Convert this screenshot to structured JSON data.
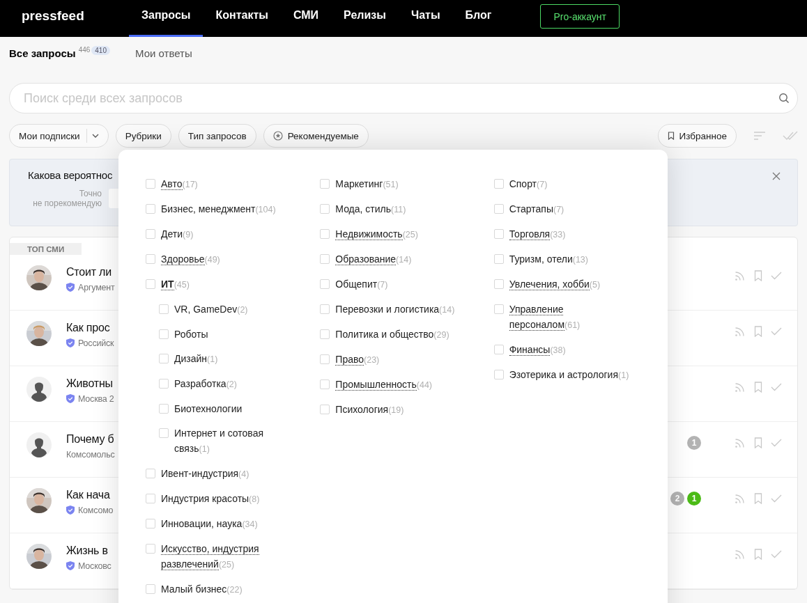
{
  "header": {
    "logo": "pressfeed",
    "nav": [
      {
        "label": "Запросы",
        "selected": true
      },
      {
        "label": "Контакты",
        "selected": false
      },
      {
        "label": "СМИ",
        "selected": false
      },
      {
        "label": "Релизы",
        "selected": false
      },
      {
        "label": "Чаты",
        "selected": false
      },
      {
        "label": "Блог",
        "selected": false
      }
    ],
    "pro_button": "Pro-аккаунт"
  },
  "subtabs": [
    {
      "label": "Все запросы",
      "count": "446",
      "badge": "410",
      "selected": true
    },
    {
      "label": "Мои ответы",
      "selected": false
    }
  ],
  "search": {
    "placeholder": "Поиск среди всех запросов"
  },
  "filters": [
    {
      "label": "Мои подписки",
      "kind": "dropdown"
    },
    {
      "label": "Рубрики",
      "kind": "plain"
    },
    {
      "label": "Тип запросов",
      "kind": "plain"
    },
    {
      "label": "Рекомендуемые",
      "kind": "star"
    }
  ],
  "favorites": "Избранное",
  "banner": {
    "question": "Какова вероятнос",
    "scale_low": [
      "Точно",
      "не порекомендую"
    ]
  },
  "list": {
    "tag": "ТОП СМИ",
    "rows": [
      {
        "title": "Стоит ли",
        "source": "Аргумент",
        "verified": true,
        "avatar": {
          "kind": "picture"
        },
        "badges": []
      },
      {
        "title": "Как прос",
        "source": "Российск",
        "verified": true,
        "avatar": {
          "kind": "picture"
        },
        "badges": []
      },
      {
        "title": "Животны",
        "source": "Москва 2",
        "verified": true,
        "avatar": {
          "kind": "silhouette"
        },
        "badges": []
      },
      {
        "title": "Почему б",
        "source": "Комсомольс",
        "verified": false,
        "avatar": {
          "kind": "silhouette"
        },
        "badges": [
          {
            "text": "1",
            "color": "#b3b3b3"
          }
        ]
      },
      {
        "title": "Как нача",
        "source": "Комсомо",
        "verified": true,
        "avatar": {
          "kind": "picture"
        },
        "badges": [
          {
            "text": "2",
            "color": "#b3b3b3"
          },
          {
            "text": "1",
            "color": "#4cbb17"
          }
        ]
      },
      {
        "title": "Жизнь в",
        "source": "Московс",
        "verified": true,
        "avatar": {
          "kind": "picture"
        },
        "badges": []
      }
    ]
  },
  "rubrics": {
    "columns": [
      [
        {
          "label": "Авто",
          "count": "(17)",
          "dotted": true,
          "checked": false
        },
        {
          "label": "Бизнес, менеджмент",
          "count": "(104)",
          "dotted": false,
          "checked": false
        },
        {
          "label": "Дети",
          "count": "(9)",
          "dotted": false,
          "checked": false
        },
        {
          "label": "Здоровье",
          "count": "(49)",
          "dotted": true,
          "checked": false
        },
        {
          "label": "ИТ",
          "count": "(45)",
          "dotted": true,
          "checked": false,
          "expanded": true,
          "children": [
            {
              "label": "VR, GameDev",
              "count": "(2)",
              "dotted": false,
              "checked": false
            },
            {
              "label": "Роботы",
              "dotted": false,
              "checked": false
            },
            {
              "label": "Дизайн",
              "count": "(1)",
              "dotted": false,
              "checked": false
            },
            {
              "label": "Разработка",
              "count": "(2)",
              "dotted": false,
              "checked": false
            },
            {
              "label": "Биотехнологии",
              "dotted": false,
              "checked": false
            },
            {
              "label": "Интернет и сотовая связь",
              "count": "(1)",
              "dotted": false,
              "checked": false
            }
          ]
        },
        {
          "label": "Ивент-индустрия",
          "count": "(4)",
          "dotted": false,
          "checked": false
        },
        {
          "label": "Индустрия красоты",
          "count": "(8)",
          "dotted": false,
          "checked": false
        },
        {
          "label": "Инновации, наука",
          "count": "(34)",
          "dotted": false,
          "checked": false
        },
        {
          "label": "Искусство, индустрия развлечений",
          "count": "(25)",
          "dotted": true,
          "checked": false
        },
        {
          "label": "Малый бизнес",
          "count": "(22)",
          "dotted": false,
          "checked": false
        }
      ],
      [
        {
          "label": "Маркетинг",
          "count": "(51)",
          "dotted": false,
          "checked": false
        },
        {
          "label": "Мода, стиль",
          "count": "(11)",
          "dotted": false,
          "checked": false
        },
        {
          "label": "Недвижимость",
          "count": "(25)",
          "dotted": true,
          "checked": false
        },
        {
          "label": "Образование",
          "count": "(14)",
          "dotted": true,
          "checked": false
        },
        {
          "label": "Общепит",
          "count": "(7)",
          "dotted": false,
          "checked": false
        },
        {
          "label": "Перевозки и логистика",
          "count": "(14)",
          "dotted": false,
          "checked": false
        },
        {
          "label": "Политика и общество",
          "count": "(29)",
          "dotted": false,
          "checked": false
        },
        {
          "label": "Право",
          "count": "(23)",
          "dotted": true,
          "checked": false
        },
        {
          "label": "Промышленность",
          "count": "(44)",
          "dotted": true,
          "checked": false
        },
        {
          "label": "Психология",
          "count": "(19)",
          "dotted": false,
          "checked": false
        }
      ],
      [
        {
          "label": "Спорт",
          "count": "(7)",
          "dotted": false,
          "checked": false
        },
        {
          "label": "Стартапы",
          "count": "(7)",
          "dotted": false,
          "checked": false
        },
        {
          "label": "Торговля",
          "count": "(33)",
          "dotted": true,
          "checked": false
        },
        {
          "label": "Туризм, отели",
          "count": "(13)",
          "dotted": false,
          "checked": false
        },
        {
          "label": "Увлечения, хобби",
          "count": "(5)",
          "dotted": true,
          "checked": false
        },
        {
          "label": "Управление персоналом",
          "count": "(61)",
          "dotted": true,
          "checked": false
        },
        {
          "label": "Финансы",
          "count": "(38)",
          "dotted": true,
          "checked": false
        },
        {
          "label": "Эзотерика и астрология",
          "count": "(1)",
          "dotted": false,
          "checked": false
        }
      ]
    ]
  }
}
